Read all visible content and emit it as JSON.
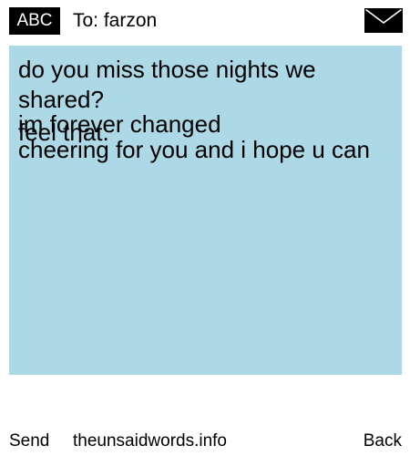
{
  "header": {
    "input_mode": "ABC",
    "to_label": "To: farzon",
    "envelope_icon": "envelope-icon"
  },
  "message": {
    "lines": [
      "do you miss those nights we",
      "shared?",
      "im forever changed",
      "feel that.",
      "cheering for you and i hope u can"
    ]
  },
  "colors": {
    "message_background": "#add8e6",
    "badge_background": "#000000"
  },
  "footer": {
    "send_label": "Send",
    "site_label": "theunsaidwords.info",
    "back_label": "Back"
  }
}
